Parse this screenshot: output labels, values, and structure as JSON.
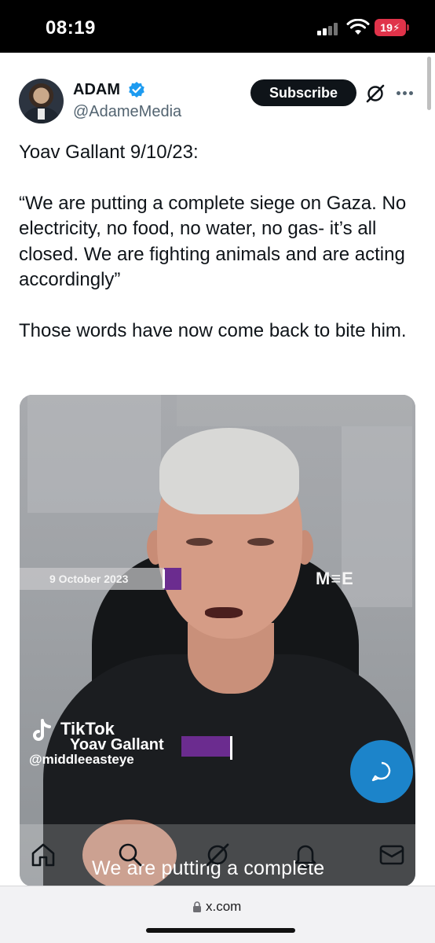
{
  "status_bar": {
    "time": "08:19",
    "battery": "19"
  },
  "tweet": {
    "author": {
      "display_name": "ADAM",
      "handle": "@AdameMedia",
      "verified": true
    },
    "subscribe_label": "Subscribe",
    "text": {
      "line1": "Yoav Gallant 9/10/23:",
      "quote": "“We are putting a complete siege on Gaza. No electricity, no food, no water, no gas- it’s all closed. We are fighting animals and are acting accordingly”",
      "closing": "Those words have now come back to bite him."
    }
  },
  "video": {
    "date_banner": "9 October 2023",
    "brand_logo": "M≡E",
    "tiktok_label": "TikTok",
    "lower_third": "Yoav Gallant",
    "tiktok_handle": "@middleeasteye",
    "subtitle": "We are putting a complete"
  },
  "bottom_nav": {
    "items": [
      {
        "icon": "home-icon"
      },
      {
        "icon": "search-icon"
      },
      {
        "icon": "grok-icon"
      },
      {
        "icon": "notifications-icon"
      },
      {
        "icon": "messages-icon"
      }
    ]
  },
  "browser": {
    "url": "x.com"
  },
  "colors": {
    "accent": "#1d9bf0",
    "text_primary": "#0f1419",
    "text_secondary": "#536471",
    "battery_low": "#e0334a",
    "overlay_purple": "#6b2c8f"
  }
}
